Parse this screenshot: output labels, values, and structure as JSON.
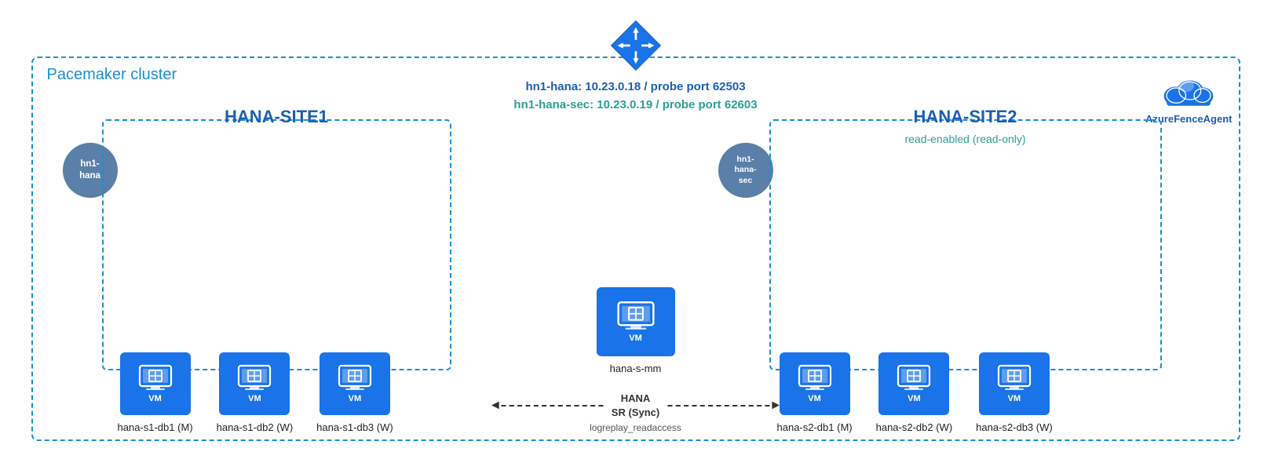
{
  "diagram": {
    "cluster_label": "Pacemaker cluster",
    "lb_primary": "hn1-hana:  10.23.0.18 / probe port 62503",
    "lb_secondary": "hn1-hana-sec:  10.23.0.19 / probe port 62603",
    "fence_agent_label": "AzureFenceAgent",
    "node_primary": "hn1-\nhana",
    "node_secondary": "hn1-\nhana-\nsec",
    "site1_title": "HANA-SITE1",
    "site2_title": "HANA-SITE2",
    "read_enabled": "read-enabled (read-only)",
    "site1_vms": [
      {
        "label": "hana-s1-db1 (M)"
      },
      {
        "label": "hana-s1-db2 (W)"
      },
      {
        "label": "hana-s1-db3 (W)"
      }
    ],
    "middle_vm": {
      "label": "hana-s-mm"
    },
    "site2_vms": [
      {
        "label": "hana-s2-db1 (M)"
      },
      {
        "label": "hana-s2-db2 (W)"
      },
      {
        "label": "hana-s2-db3 (W)"
      }
    ],
    "sync_label": "HANA\nSR (Sync)",
    "sync_sub": "logreplay_readaccess",
    "vm_text": "VM"
  }
}
